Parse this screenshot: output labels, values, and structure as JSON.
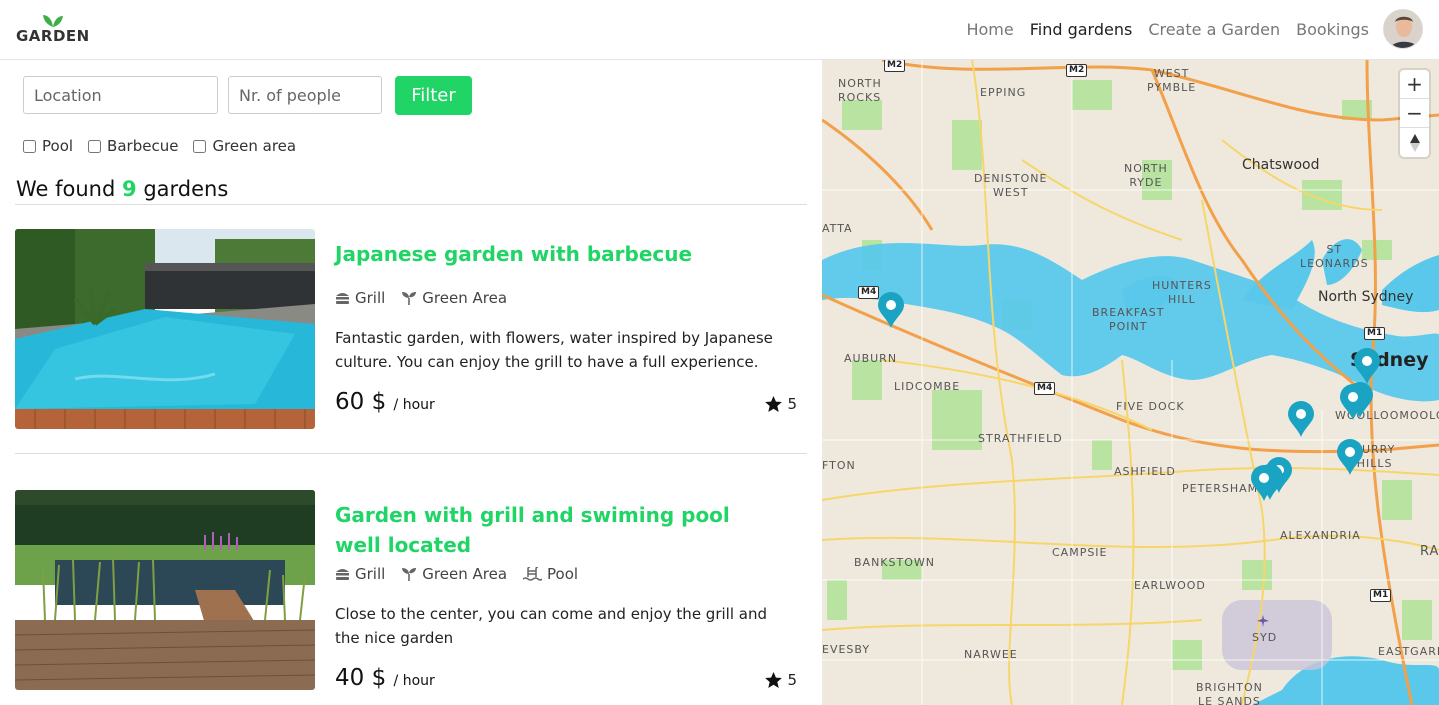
{
  "brand": {
    "name": "GARDEN",
    "accent": "#21d466"
  },
  "nav": {
    "items": [
      {
        "label": "Home",
        "active": false
      },
      {
        "label": "Find gardens",
        "active": true
      },
      {
        "label": "Create a Garden",
        "active": false
      },
      {
        "label": "Bookings",
        "active": false
      }
    ]
  },
  "filters": {
    "location_placeholder": "Location",
    "people_placeholder": "Nr. of people",
    "button_label": "Filter",
    "checkboxes": [
      {
        "label": "Pool",
        "checked": false
      },
      {
        "label": "Barbecue",
        "checked": false
      },
      {
        "label": "Green area",
        "checked": false
      }
    ]
  },
  "results": {
    "prefix": "We found",
    "count": "9",
    "suffix": "gardens"
  },
  "gardens": [
    {
      "title": "Japanese garden with barbecue",
      "features": [
        "Grill",
        "Green Area"
      ],
      "feature_icons": [
        "grill-icon",
        "sprout-icon"
      ],
      "description": "Fantastic garden, with flowers, water inspired by Japanese culture. You can enjoy the grill to have a full experience.",
      "price": "60 $",
      "price_unit": "/ hour",
      "rating": "5"
    },
    {
      "title": "Garden with grill and swiming pool well located",
      "features": [
        "Grill",
        "Green Area",
        "Pool"
      ],
      "feature_icons": [
        "grill-icon",
        "sprout-icon",
        "pool-icon"
      ],
      "description": "Close to the center, you can come and enjoy the grill and the nice garden",
      "price": "40 $",
      "price_unit": "/ hour",
      "rating": "5"
    }
  ],
  "map": {
    "zoom_in": "+",
    "zoom_out": "−",
    "compass": "▲",
    "marker_color": "#1aa3c2",
    "labels": {
      "north_rocks": "NORTH\nROCKS",
      "west_pymble": "WEST\nPYMBLE",
      "epping": "EPPING",
      "north_ryde": "NORTH\nRYDE",
      "chatswood": "Chatswood",
      "denistone_west": "DENISTONE\nWEST",
      "st_leonards": "ST\nLEONARDS",
      "hunters_hill": "HUNTERS\nHILL",
      "north_sydney": "North Sydney",
      "breakfast_point": "BREAKFAST\nPOINT",
      "auburn": "AUBURN",
      "lidcombe": "LIDCOMBE",
      "sydney": "Sydney",
      "five_dock": "FIVE DOCK",
      "woolloomooloo": "WOOLLOOMOOLOO",
      "strathfield": "STRATHFIELD",
      "ashfield": "ASHFIELD",
      "surry_hills": "SURRY\nHILLS",
      "petersham": "PETERSHAM",
      "alexandria": "ALEXANDRIA",
      "campsie": "CAMPSIE",
      "bankstown": "BANKSTOWN",
      "earlwood": "EARLWOOD",
      "syd": "SYD",
      "eastgardens": "EASTGARDEN",
      "narwee": "NARWEE",
      "brighton": "BRIGHTON\nLE SANDS",
      "revesby": "EVESBY",
      "ifton": "FTON",
      "atta": "ATTA",
      "ran": "RAN"
    },
    "shields": [
      "M2",
      "M2",
      "M4",
      "M4",
      "M1",
      "M1"
    ]
  }
}
